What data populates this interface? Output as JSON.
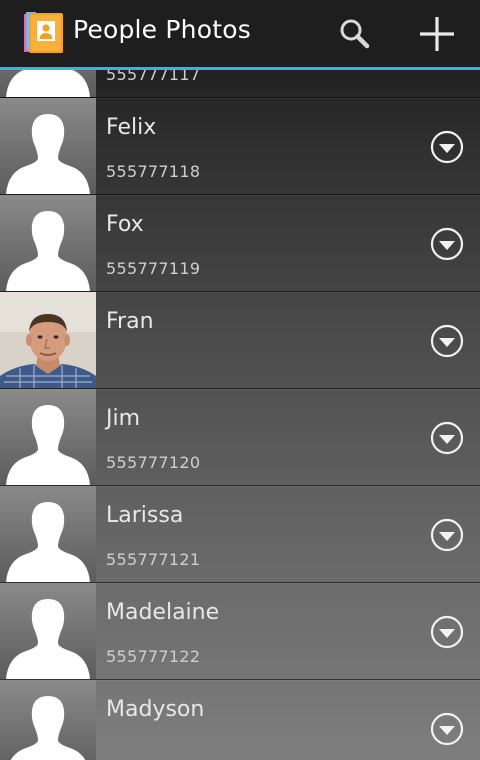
{
  "app": {
    "title": "People Photos",
    "icon": "contacts-book-icon",
    "accent_color": "#33b5e5"
  },
  "actions": {
    "search_icon": "search-icon",
    "add_icon": "plus-icon"
  },
  "contacts": [
    {
      "name": "",
      "phone": "555777117",
      "photo": "silhouette"
    },
    {
      "name": "Felix",
      "phone": "555777118",
      "photo": "silhouette"
    },
    {
      "name": "Fox",
      "phone": "555777119",
      "photo": "silhouette"
    },
    {
      "name": "Fran",
      "phone": "",
      "photo": "portrait"
    },
    {
      "name": "Jim",
      "phone": "555777120",
      "photo": "silhouette"
    },
    {
      "name": "Larissa",
      "phone": "555777121",
      "photo": "silhouette"
    },
    {
      "name": "Madelaine",
      "phone": "555777122",
      "photo": "silhouette"
    },
    {
      "name": "Madyson",
      "phone": "",
      "photo": "silhouette"
    }
  ]
}
